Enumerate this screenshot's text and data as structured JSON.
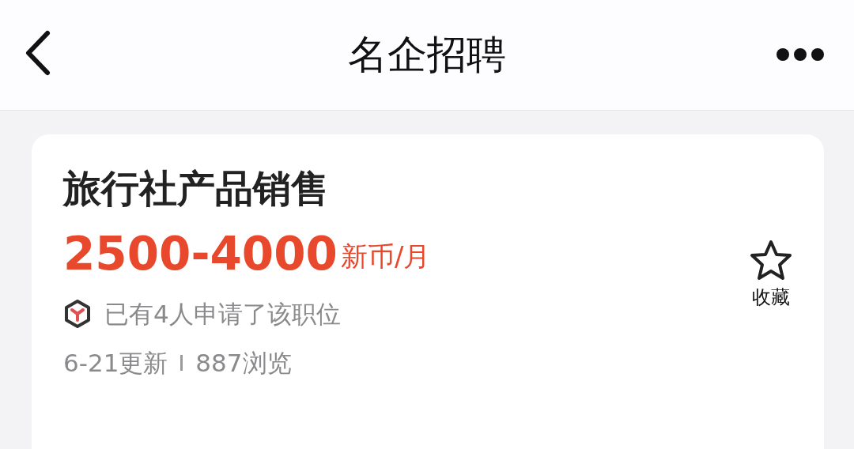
{
  "header": {
    "title": "名企招聘"
  },
  "job": {
    "title": "旅行社产品销售",
    "salary": "2500-4000",
    "salary_unit": "新币/月",
    "applicants": "已有4人申请了该职位",
    "updated": "6-21更新",
    "views": "887浏览",
    "favorite": {
      "label": "收藏",
      "favorited": false
    }
  }
}
